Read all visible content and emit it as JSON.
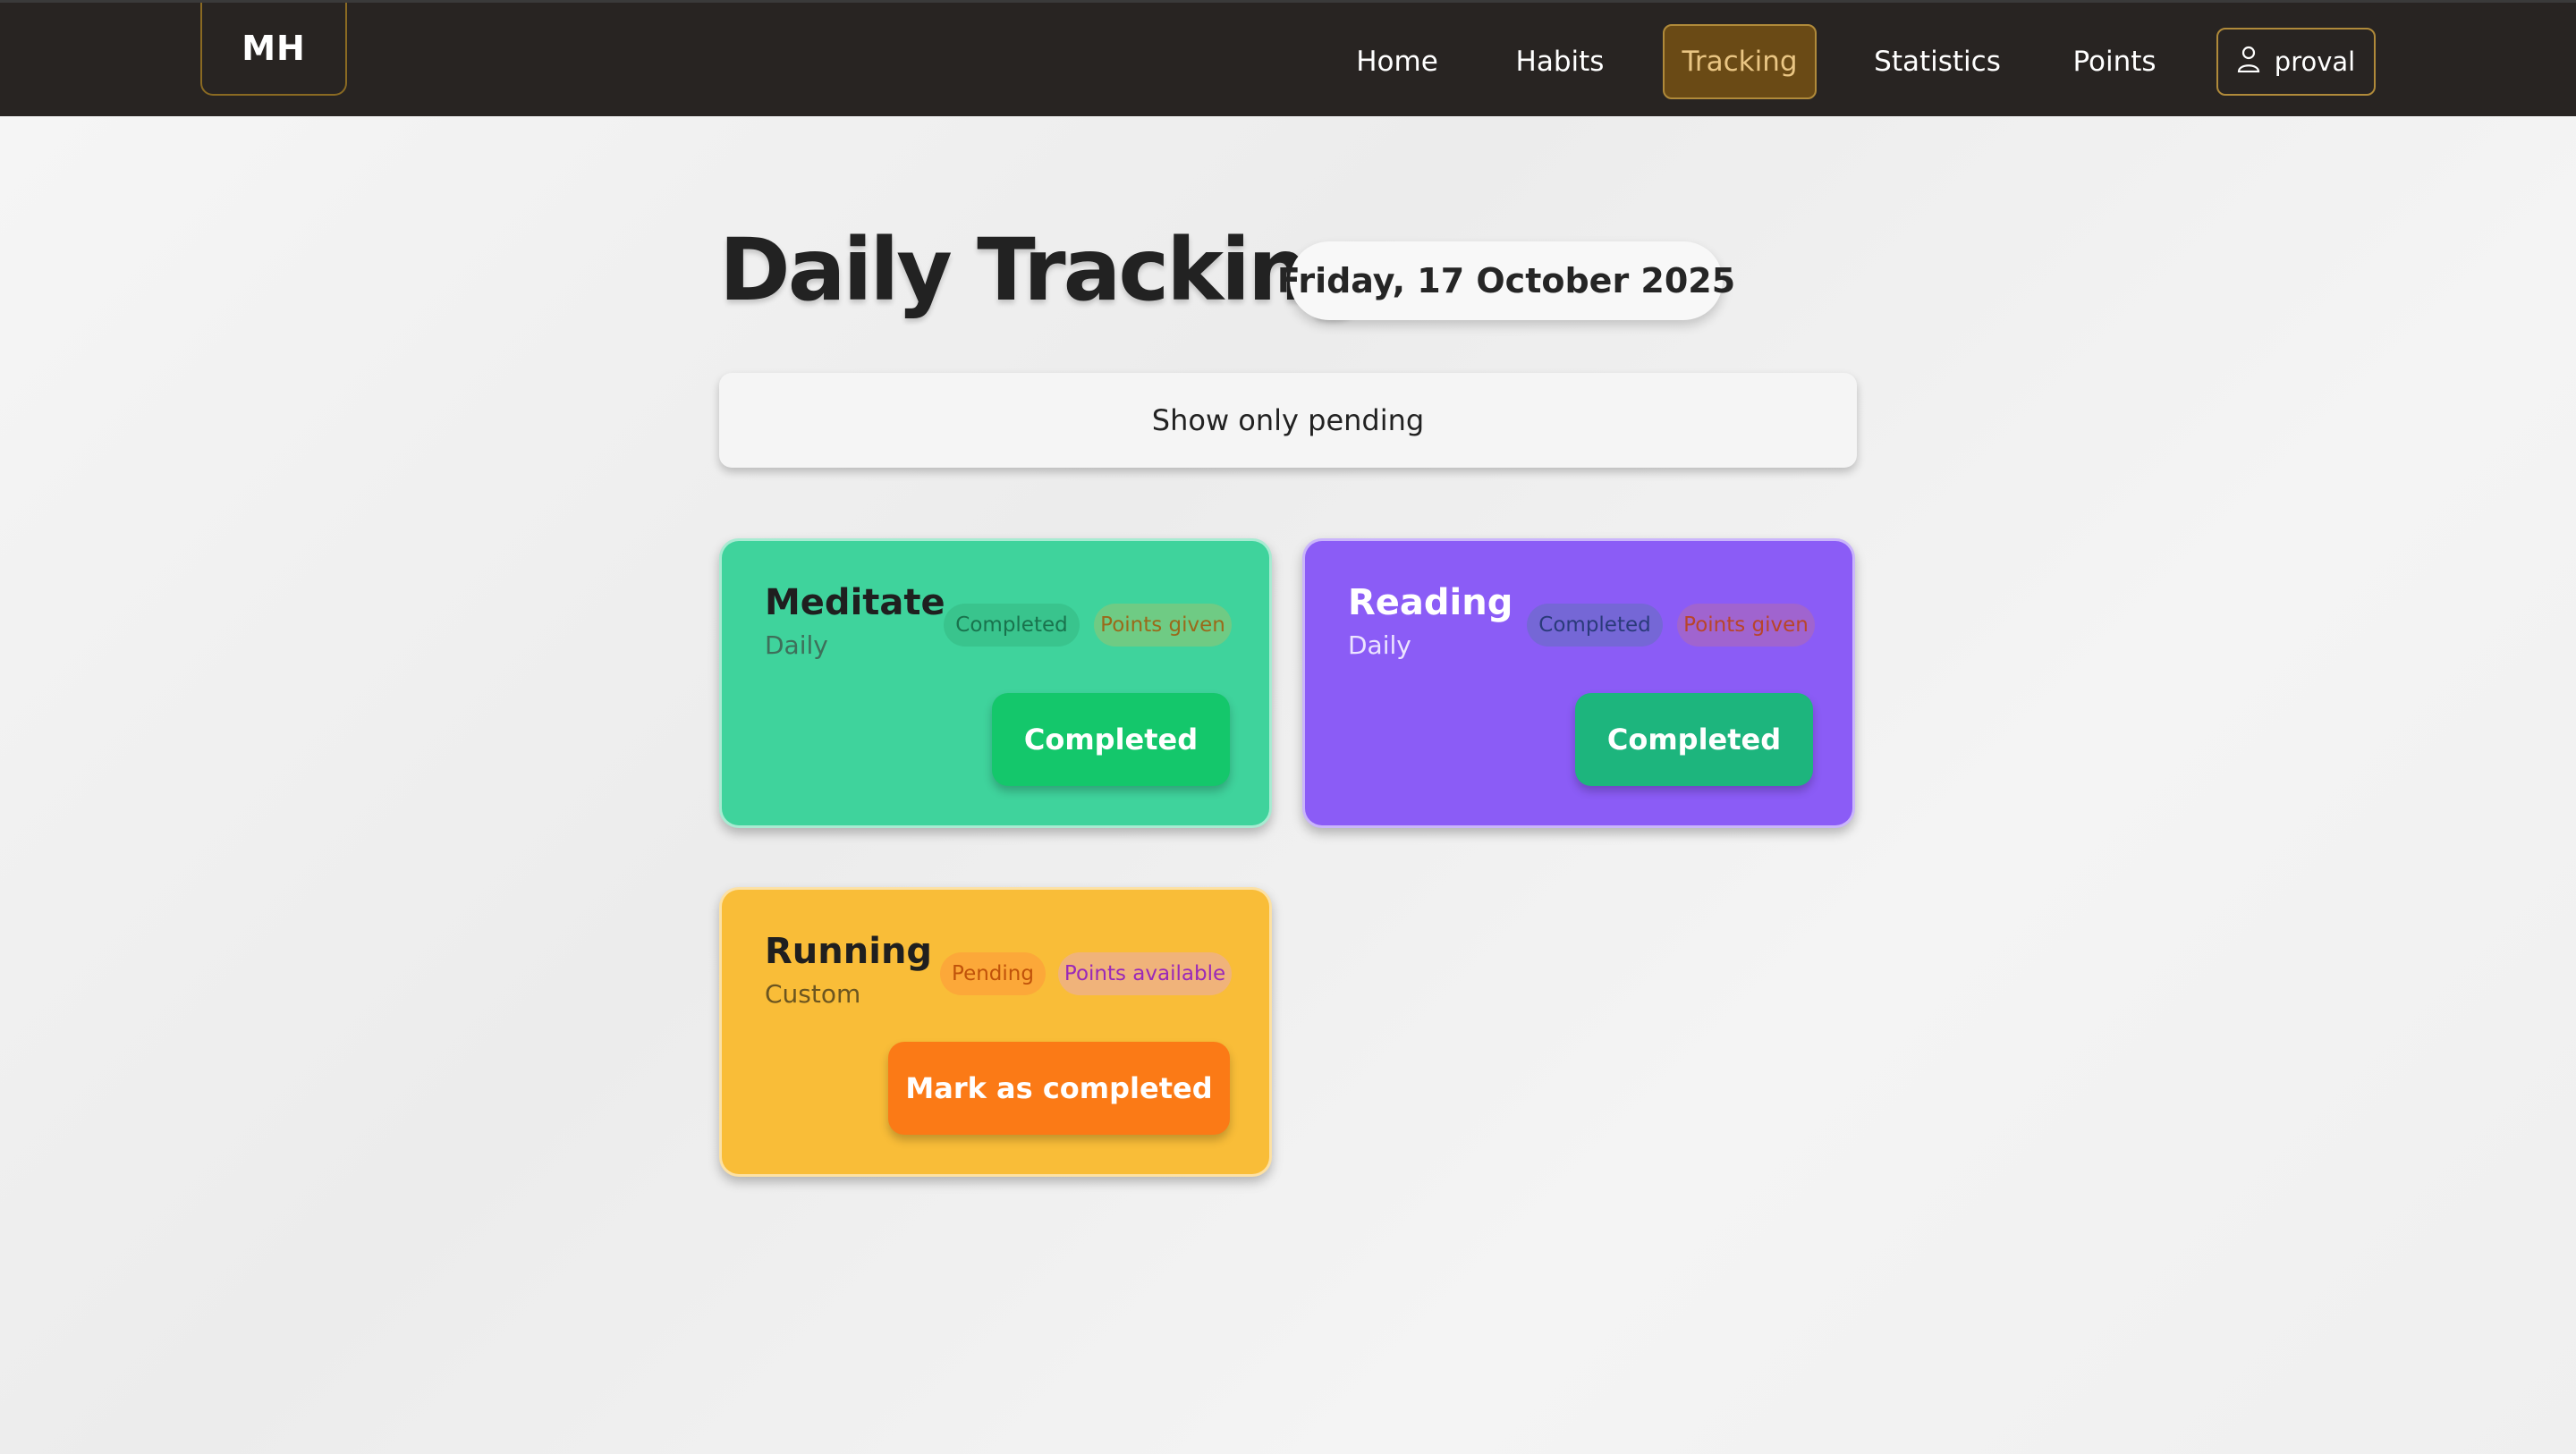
{
  "navbar": {
    "logo": "MH",
    "links": [
      {
        "label": "Home",
        "active": false
      },
      {
        "label": "Habits",
        "active": false
      },
      {
        "label": "Tracking",
        "active": true
      },
      {
        "label": "Statistics",
        "active": false
      },
      {
        "label": "Points",
        "active": false
      }
    ],
    "user": {
      "label": "proval",
      "icon": "user-icon"
    }
  },
  "header": {
    "title": "Daily Tracking",
    "date": "Friday, 17 October 2025"
  },
  "filter": {
    "label": "Show only pending"
  },
  "habits": [
    {
      "name": "Meditate",
      "frequency": "Daily",
      "status_badge": "Completed",
      "points_badge": "Points given",
      "action_label": "Completed",
      "color": "#3fd39c"
    },
    {
      "name": "Reading",
      "frequency": "Daily",
      "status_badge": "Completed",
      "points_badge": "Points given",
      "action_label": "Completed",
      "color": "#8b5cf6"
    },
    {
      "name": "Running",
      "frequency": "Custom",
      "status_badge": "Pending",
      "points_badge": "Points available",
      "action_label": "Mark as completed",
      "color": "#f9bd38"
    }
  ],
  "colors": {
    "navbar_bg": "#282422",
    "accent": "#6a4a15",
    "accent_border": "#b08a3a"
  }
}
